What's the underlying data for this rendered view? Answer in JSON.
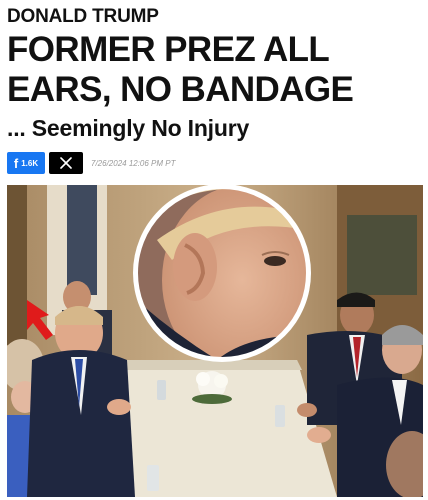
{
  "article": {
    "kicker": "DONALD TRUMP",
    "headline": "FORMER PREZ ALL EARS, NO BANDAGE",
    "subheadline": "... Seemingly No Injury",
    "timestamp": "7/26/2024 12:06 PM PT"
  },
  "share": {
    "facebook_count": "1.6K",
    "facebook_icon": "facebook-icon",
    "x_icon": "x-logo-icon"
  },
  "photo": {
    "inset": "circular close-up of ear",
    "arrow_color": "#e01b1b"
  },
  "colors": {
    "facebook": "#1877f2",
    "x": "#000000",
    "text": "#111111",
    "timestamp": "#9a9a9a"
  }
}
